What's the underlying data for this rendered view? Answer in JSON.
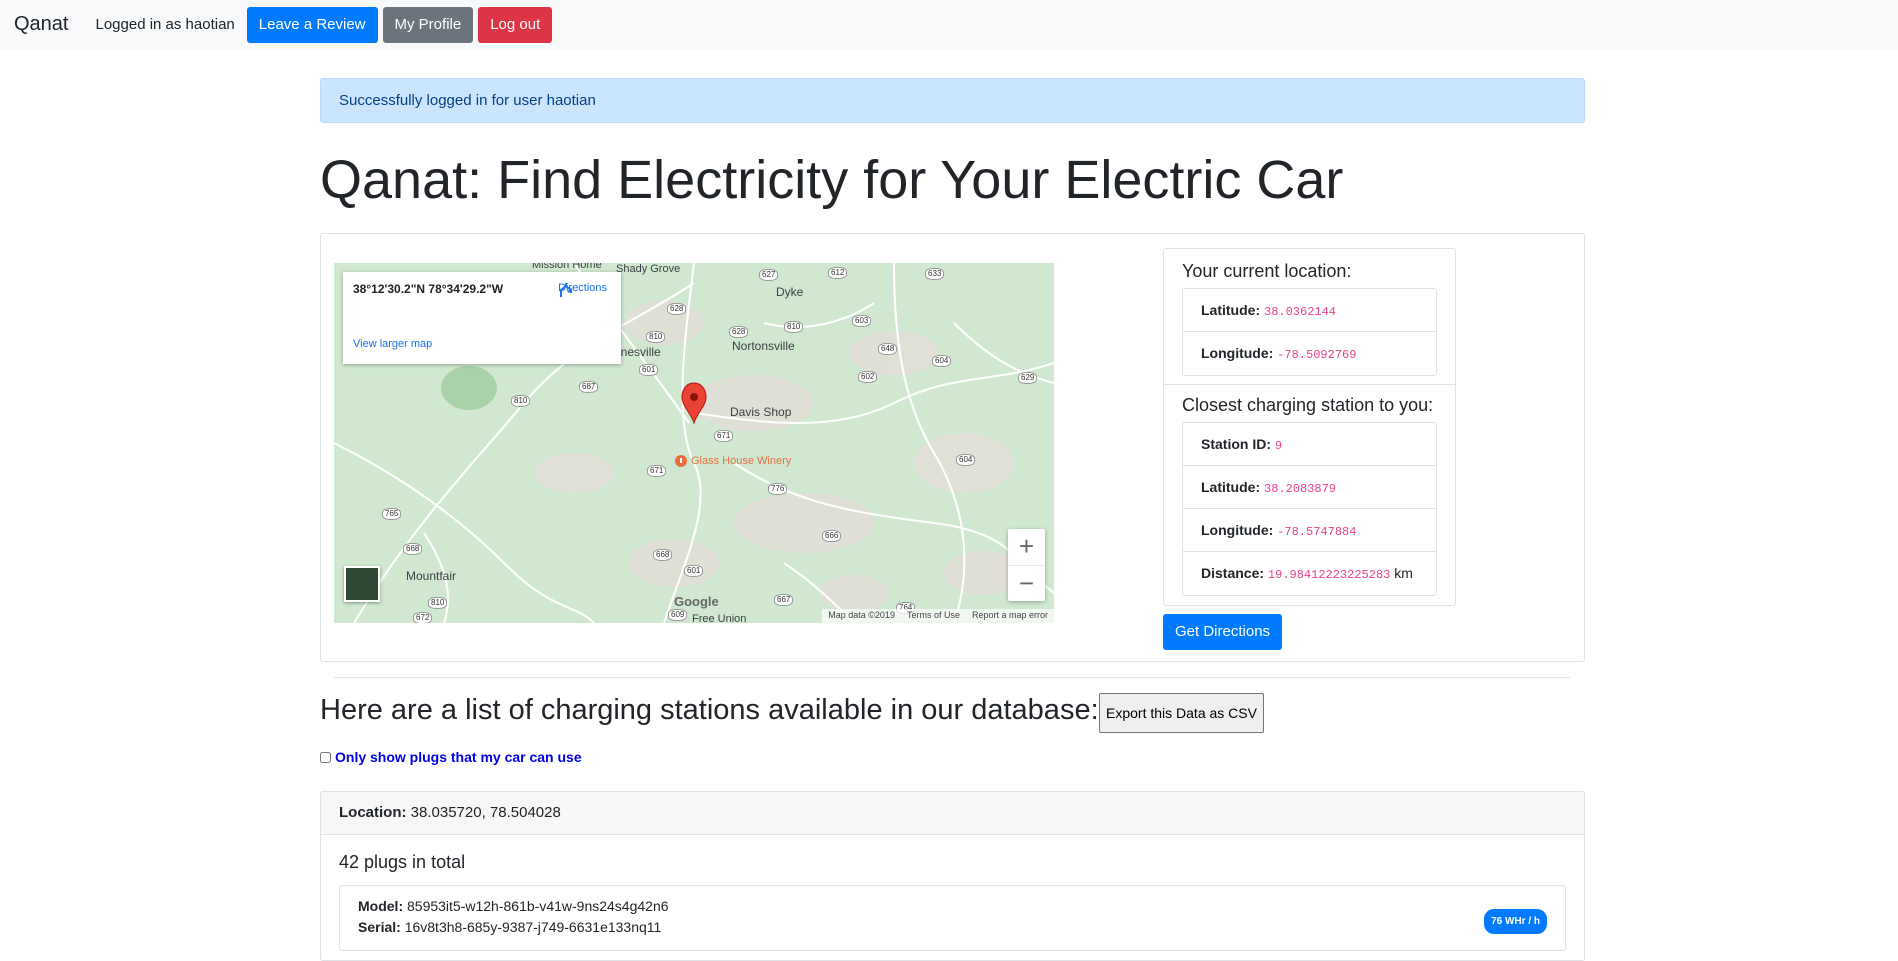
{
  "navbar": {
    "brand": "Qanat",
    "logged_in_text": "Logged in as haotian",
    "review_button": "Leave a Review",
    "profile_button": "My Profile",
    "logout_button": "Log out"
  },
  "alert": {
    "message": "Successfully logged in for user haotian"
  },
  "page_title": "Qanat: Find Electricity for Your Electric Car",
  "map": {
    "popup_coords": "38°12'30.2\"N 78°34'29.2\"W",
    "directions_label": "Directions",
    "larger_map_link": "View larger map",
    "zoom_in": "+",
    "zoom_out": "−",
    "google_logo": "Google",
    "footer": [
      "Map data ©2019",
      "Terms of Use",
      "Report a map error"
    ],
    "places": {
      "mission_home": "Mission Home",
      "shady_grove": "Shady Grove",
      "dyke": "Dyke",
      "nortonsville": "Nortonsville",
      "boonesville": "onesville",
      "davis_shop": "Davis Shop",
      "glass_house": "Glass House Winery",
      "mountfair": "Mountfair",
      "free_union": "Free Union"
    },
    "shields": {
      "s627": "627",
      "s612": "612",
      "s633": "633",
      "s628a": "628",
      "s628b": "628",
      "s810a": "810",
      "s810b": "810",
      "s603": "603",
      "s648": "648",
      "s604a": "604",
      "s601a": "601",
      "s687": "687",
      "s602": "602",
      "s629": "629",
      "s810c": "810",
      "s671a": "671",
      "s671b": "671",
      "s776": "776",
      "s604b": "604",
      "s765": "765",
      "s668a": "668",
      "s668b": "668",
      "s666": "666",
      "s601b": "601",
      "s810d": "810",
      "s672": "672",
      "s609": "609",
      "s667": "667",
      "s764": "764"
    }
  },
  "location_card": {
    "current_title": "Your current location:",
    "current": [
      {
        "label": "Latitude:",
        "value": "38.0362144"
      },
      {
        "label": "Longitude:",
        "value": "-78.5092769"
      }
    ],
    "closest_title": "Closest charging station to you:",
    "closest": [
      {
        "label": "Station ID:",
        "value": "9",
        "unit": ""
      },
      {
        "label": "Latitude:",
        "value": "38.2083879",
        "unit": ""
      },
      {
        "label": "Longitude:",
        "value": "-78.5747884",
        "unit": ""
      },
      {
        "label": "Distance:",
        "value": "19.98412223225283",
        "unit": "km"
      }
    ],
    "get_directions": "Get Directions"
  },
  "station_list": {
    "title": "Here are a list of charging stations available in our database:",
    "export_button": "Export this Data as CSV",
    "filter_label": "Only show plugs that my car can use",
    "stations": [
      {
        "location_label": "Location:",
        "location_value": "38.035720, 78.504028",
        "plug_count": "42 plugs in total",
        "plugs": [
          {
            "model_label": "Model:",
            "model": "85953it5-w12h-861b-v41w-9ns24s4g42n6",
            "serial_label": "Serial:",
            "serial": "16v8t3h8-685y-9387-j749-6631e133nq11",
            "rate": "76 WHr / h"
          }
        ]
      }
    ]
  },
  "colors": {
    "primary": "#007bff",
    "secondary": "#6c757d",
    "danger": "#dc3545",
    "alert_bg": "#cce5ff",
    "code": "#e83e8c",
    "map_pin": "#ea4335"
  }
}
